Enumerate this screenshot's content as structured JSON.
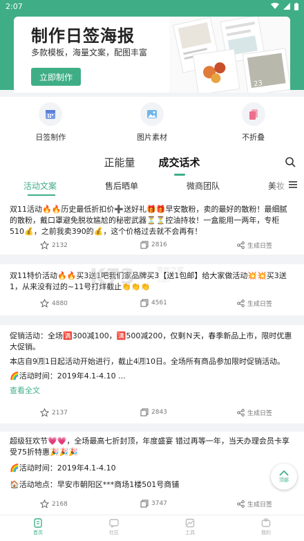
{
  "status_bar": {
    "time": "2:07"
  },
  "banner": {
    "title": "制作日签海报",
    "subtitle": "多款模板，海量文案，配图丰富",
    "button": "立即制作"
  },
  "quick_actions": [
    {
      "label": "日签制作",
      "icon": "calendar-icon"
    },
    {
      "label": "图片素材",
      "icon": "image-icon"
    },
    {
      "label": "不折叠",
      "icon": "copy-doc-icon"
    }
  ],
  "category_tabs": [
    {
      "label": "正能量",
      "active": false
    },
    {
      "label": "成交话术",
      "active": true
    }
  ],
  "sub_tabs": [
    {
      "label": "活动文案",
      "active": true
    },
    {
      "label": "售后晒单",
      "active": false
    },
    {
      "label": "微商团队",
      "active": false
    },
    {
      "label": "美妆",
      "active": false
    }
  ],
  "action_labels": {
    "share": "生成日签"
  },
  "posts": [
    {
      "text": "双11活动🔥🔥历史最低折扣价➕送好礼🎁🎁早安散粉，卖的最好的散粉！最细腻的散粉，戴口罩避免脱妆尴尬的秘密武器⏳⏳控油持妆！一盒能用一两年，专柜510💰，之前我卖390的💰，这个价格过去就不会再有！",
      "likes": "2132",
      "copies": "2816"
    },
    {
      "text": "双11特价活动🔥🔥买3送1吧我们家品牌买3【送1包邮】给大家做活动💥💥买3送1，从来没有过的~11号打烊截止👏👏👏",
      "likes": "4880",
      "copies": "4561"
    },
    {
      "text": "促销活动：全场🈵300减100，🈵500减200，仅剩Ｎ天，春季新品上市，限时优惠大促销。",
      "line2": "本店自9🈷1日起活动开始进行，截止4🈷10日。全场所有商品参加限时促销活动。",
      "line3": "🌈活动时间：2019年4.1-4.10 ...",
      "link": "查看全文",
      "likes": "2137",
      "copies": "2843"
    },
    {
      "text": "超级狂欢节💗💗，全场最高七折封顶，年度盛宴 错过再等一年，当天办理会员卡享受75折特惠🎉🎉🎉",
      "line2": "🌈活动时间：2019年4.1-4.10",
      "line3": "🏠活动地点：早安市朝阳区***商场1楼501号商铺",
      "likes": "2168",
      "copies": "3747"
    }
  ],
  "float_button": {
    "label": "顶部"
  },
  "bottom_nav": [
    {
      "label": "首页",
      "active": true
    },
    {
      "label": "社区",
      "active": false
    },
    {
      "label": "工具",
      "active": false
    },
    {
      "label": "我的",
      "active": false
    }
  ],
  "colors": {
    "accent": "#3fae87",
    "background": "#f2f3f5"
  }
}
